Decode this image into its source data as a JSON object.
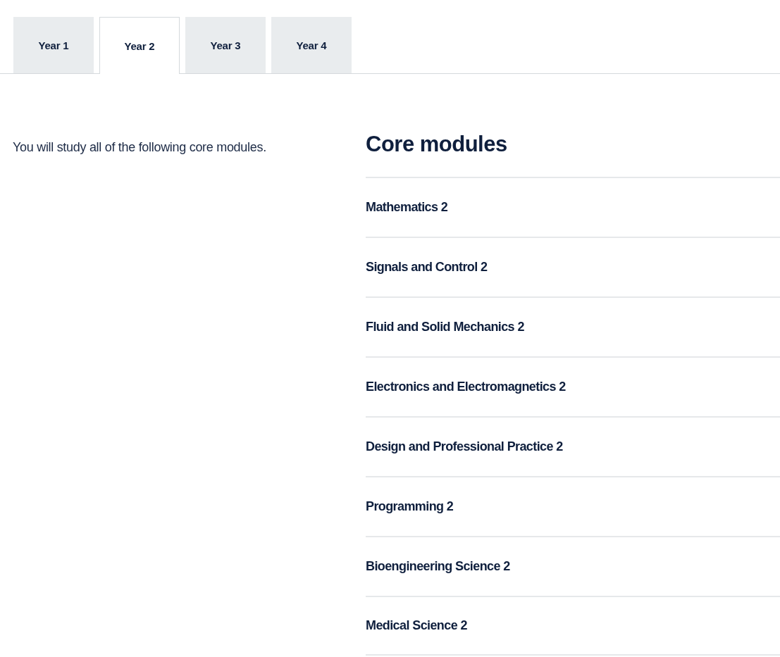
{
  "tabs": [
    {
      "label": "Year 1",
      "selected": false
    },
    {
      "label": "Year 2",
      "selected": true
    },
    {
      "label": "Year 3",
      "selected": false
    },
    {
      "label": "Year 4",
      "selected": false
    }
  ],
  "intro": "You will study all of the following core modules.",
  "core_modules": {
    "heading": "Core modules",
    "items": [
      "Mathematics 2",
      "Signals and Control 2",
      "Fluid and Solid Mechanics 2",
      "Electronics and Electromagnetics 2",
      "Design and Professional Practice 2",
      "Programming 2",
      "Bioengineering Science 2",
      "Medical Science 2"
    ]
  }
}
